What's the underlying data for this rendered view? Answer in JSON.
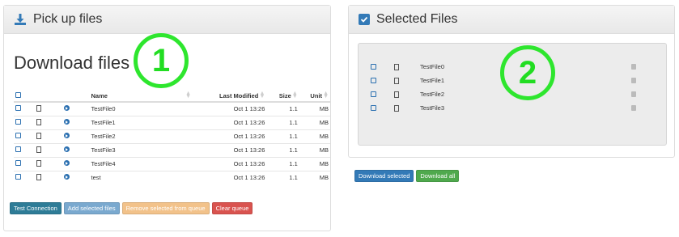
{
  "left_panel": {
    "title": "Pick up files",
    "heading": "Download files",
    "marker": "1",
    "columns": [
      "",
      "",
      "",
      "Name",
      "Last Modified",
      "Size",
      "Unit"
    ],
    "rows": [
      {
        "name": "TestFile0",
        "modified": "Oct 1 13:26",
        "size": "1.1",
        "unit": "MB"
      },
      {
        "name": "TestFile1",
        "modified": "Oct 1 13:26",
        "size": "1.1",
        "unit": "MB"
      },
      {
        "name": "TestFile2",
        "modified": "Oct 1 13:26",
        "size": "1.1",
        "unit": "MB"
      },
      {
        "name": "TestFile3",
        "modified": "Oct 1 13:26",
        "size": "1.1",
        "unit": "MB"
      },
      {
        "name": "TestFile4",
        "modified": "Oct 1 13:26",
        "size": "1.1",
        "unit": "MB"
      },
      {
        "name": "test",
        "modified": "Oct 1 13:26",
        "size": "1.1",
        "unit": "MB"
      }
    ],
    "buttons": {
      "test_connection": "Test Connection",
      "add_selected": "Add selected files",
      "remove_selected": "Remove selected from queue",
      "clear_queue": "Clear queue"
    }
  },
  "right_panel": {
    "title": "Selected Files",
    "marker": "2",
    "files": [
      "TestFile0",
      "TestFile1",
      "TestFile2",
      "TestFile3"
    ],
    "buttons": {
      "download_selected": "Download selected",
      "download_all": "Download all"
    }
  },
  "colors": {
    "primary": "#337ab7",
    "info": "#2e7c97",
    "light_info": "#7aa9cf",
    "warning": "#f0ad4e",
    "danger": "#d9534f",
    "success": "#4fa94d",
    "marker": "#2ee62e"
  },
  "icons": {
    "download": "download-icon",
    "checkbox_checked": "checkbox-checked-icon",
    "file": "file-icon",
    "go": "circle-arrow-right-icon",
    "trash": "trash-icon"
  }
}
